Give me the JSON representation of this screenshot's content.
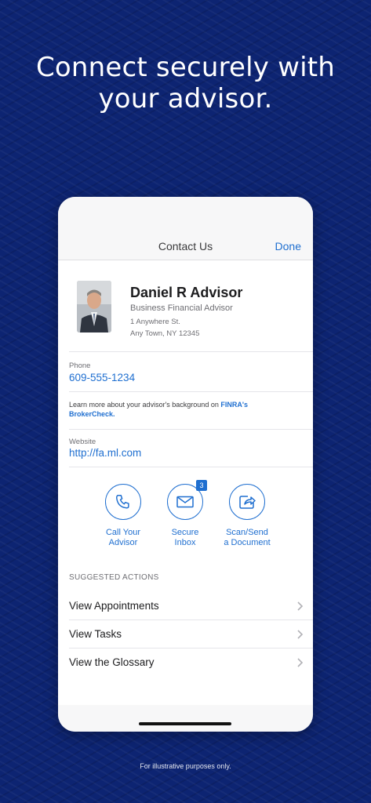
{
  "headline": {
    "line1": "Connect securely with",
    "line2": "your advisor."
  },
  "navbar": {
    "title": "Contact Us",
    "done_label": "Done"
  },
  "advisor": {
    "name": "Daniel R Advisor",
    "role": "Business Financial Advisor",
    "address_line1": "1 Anywhere St.",
    "address_line2": "Any Town, NY 12345"
  },
  "phone": {
    "label": "Phone",
    "value": "609-555-1234"
  },
  "finra": {
    "text": "Learn more about your advisor's background on ",
    "link1": "FINRA's",
    "link2": "BrokerCheck."
  },
  "website": {
    "label": "Website",
    "value": "http://fa.ml.com"
  },
  "actions": [
    {
      "line1": "Call Your",
      "line2": "Advisor",
      "icon": "phone-icon"
    },
    {
      "line1": "Secure",
      "line2": "Inbox",
      "icon": "envelope-icon",
      "badge": "3"
    },
    {
      "line1": "Scan/Send",
      "line2": "a Document",
      "icon": "share-document-icon"
    }
  ],
  "suggested": {
    "header": "SUGGESTED ACTIONS",
    "items": [
      "View Appointments",
      "View Tasks",
      "View the Glossary"
    ]
  },
  "footnote": "For illustrative purposes only.",
  "colors": {
    "background": "#0d2472",
    "accent": "#1f6fd0"
  }
}
